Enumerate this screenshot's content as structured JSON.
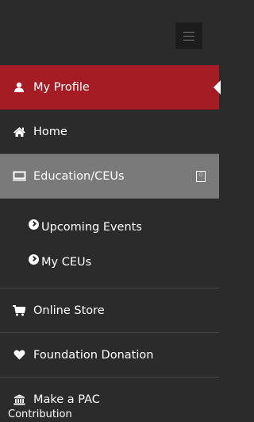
{
  "menu": {
    "toggle_icon": "hamburger-icon",
    "items": [
      {
        "label": "My Profile",
        "icon": "user-icon",
        "state": "active"
      },
      {
        "label": "Home",
        "icon": "home-icon"
      },
      {
        "label": "Education/CEUs",
        "icon": "monitor-icon",
        "state": "selected",
        "badge_icon": "pdf-icon"
      },
      {
        "label": "Online Store",
        "icon": "cart-icon"
      },
      {
        "label": "Foundation Donation",
        "icon": "heart-icon"
      },
      {
        "label": "Make a PAC",
        "icon": "bank-icon"
      }
    ],
    "submenu": [
      {
        "label": "Upcoming Events",
        "icon": "chevron-right-circle-icon"
      },
      {
        "label": "My CEUs",
        "icon": "chevron-right-circle-icon"
      }
    ],
    "cutoff_text": "Contribution"
  },
  "colors": {
    "active": "#a61c24",
    "selected": "#7a7a7a",
    "background": "#2b2b2b"
  }
}
